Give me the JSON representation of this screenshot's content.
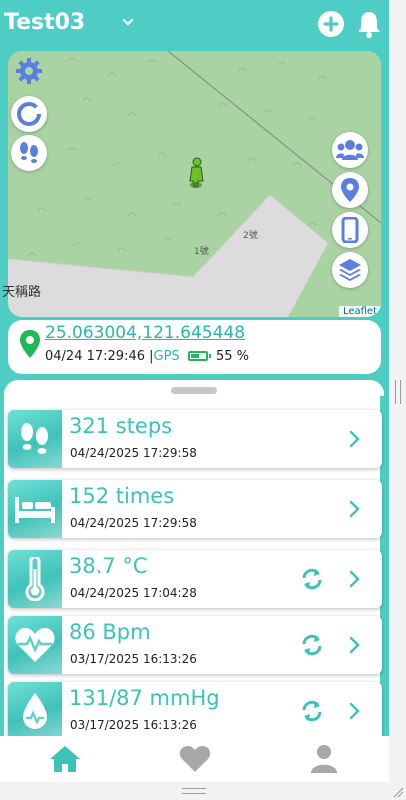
{
  "header": {
    "title": "Test03"
  },
  "map": {
    "road_label": "天稱路",
    "attribution": "Leaflet",
    "building_labels": [
      "1號",
      "2號"
    ]
  },
  "location": {
    "coords": "25.063004,121.645448",
    "datetime": "04/24 17:29:46",
    "separator": "|",
    "gps_label": "GPS",
    "battery": "55 %",
    "battery_level": 0.55
  },
  "items": [
    {
      "value": "321 steps",
      "time": "04/24/2025 17:29:58",
      "icon": "footprints-icon",
      "refresh": false
    },
    {
      "value": "152 times",
      "time": "04/24/2025 17:29:58",
      "icon": "bed-icon",
      "refresh": false
    },
    {
      "value": "38.7 °C",
      "time": "04/24/2025 17:04:28",
      "icon": "thermometer-icon",
      "refresh": true
    },
    {
      "value": "86 Bpm",
      "time": "03/17/2025 16:13:26",
      "icon": "heart-pulse-icon",
      "refresh": true
    },
    {
      "value": "131/87 mmHg",
      "time": "03/17/2025 16:13:26",
      "icon": "blood-drop-icon",
      "refresh": true
    }
  ],
  "nav": [
    "home-icon",
    "heart-icon",
    "user-icon"
  ],
  "colors": {
    "accent": "#4ecdc4",
    "accent_dark": "#2ab7a9",
    "icon_blue": "#5b7fe0",
    "map_green": "#a9d3a2",
    "battery_green": "#1fb85b"
  }
}
